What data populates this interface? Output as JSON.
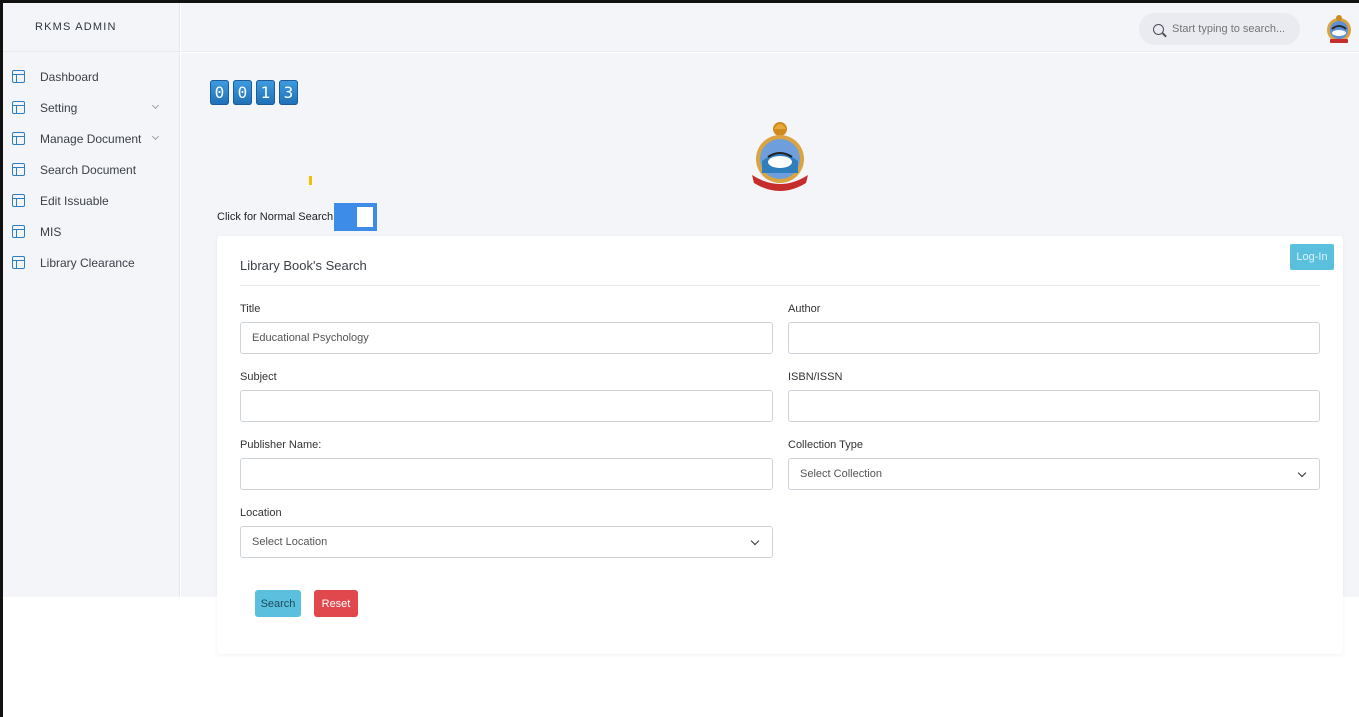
{
  "brand": "RKMS ADMIN",
  "sidebar": {
    "items": [
      {
        "label": "Dashboard"
      },
      {
        "label": "Setting"
      },
      {
        "label": "Manage Document"
      },
      {
        "label": "Search Document"
      },
      {
        "label": "Edit Issuable"
      },
      {
        "label": "MIS"
      },
      {
        "label": "Library Clearance"
      }
    ]
  },
  "header": {
    "search_placeholder": "Start typing to search..."
  },
  "counter": {
    "digits": [
      "0",
      "0",
      "1",
      "3"
    ]
  },
  "toggle": {
    "label": "Click for Normal Search",
    "on": true
  },
  "form": {
    "title": "Library Book's Search",
    "login_label": "Log-In",
    "fields": {
      "title": {
        "label": "Title",
        "value": "Educational Psychology"
      },
      "author": {
        "label": "Author",
        "value": ""
      },
      "subject": {
        "label": "Subject",
        "value": ""
      },
      "isbn": {
        "label": "ISBN/ISSN",
        "value": ""
      },
      "publisher": {
        "label": "Publisher Name:",
        "value": ""
      },
      "collection": {
        "label": "Collection Type",
        "value": "Select Collection"
      },
      "location": {
        "label": "Location",
        "value": "Select Location"
      }
    },
    "search_label": "Search",
    "reset_label": "Reset"
  },
  "icons": {
    "nav": "layout-icon",
    "search": "search-icon"
  },
  "colors": {
    "accent": "#3d8de8",
    "info": "#5bc0de",
    "danger": "#e1484e",
    "sidebar_bg": "#f4f5f8"
  }
}
